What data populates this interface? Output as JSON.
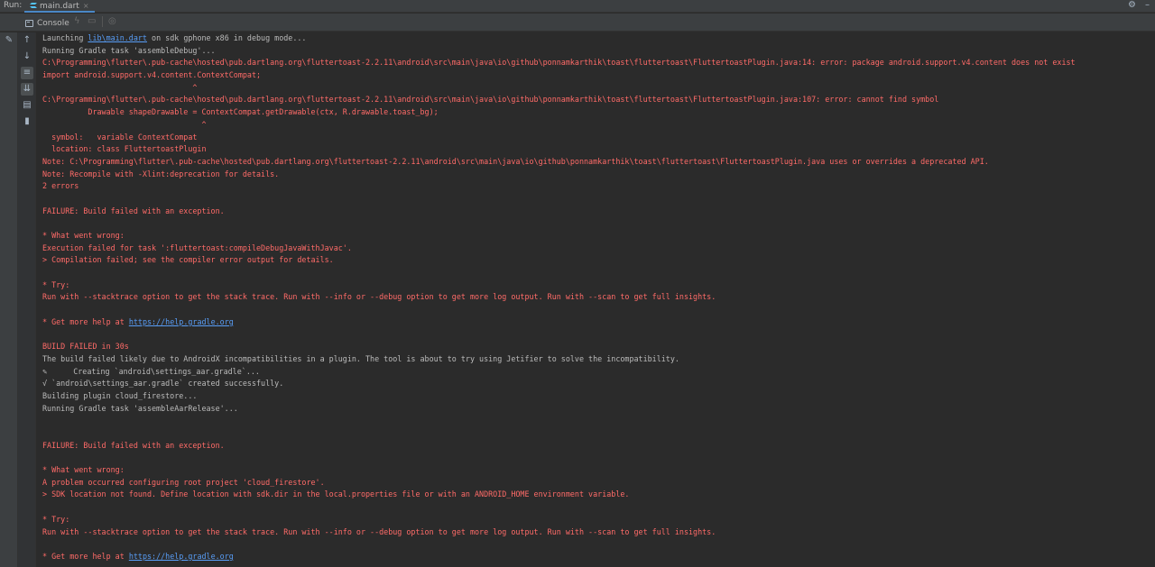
{
  "topbar": {
    "run_label": "Run:",
    "tab_label": "main.dart",
    "tab_close": "×",
    "settings_glyph": "⚙",
    "minimize_glyph": "–"
  },
  "toolbar": {
    "console_label": "Console"
  },
  "console": {
    "lines": [
      {
        "type": "normal",
        "segments": [
          {
            "text": "Launching "
          },
          {
            "text": "lib\\main.dart",
            "link": true
          },
          {
            "text": " on sdk gphone x86 in debug mode..."
          }
        ]
      },
      {
        "type": "normal",
        "text": "Running Gradle task 'assembleDebug'..."
      },
      {
        "type": "error",
        "text": "C:\\Programming\\flutter\\.pub-cache\\hosted\\pub.dartlang.org\\fluttertoast-2.2.11\\android\\src\\main\\java\\io\\github\\ponnamkarthik\\toast\\fluttertoast\\FluttertoastPlugin.java:14: error: package android.support.v4.content does not exist"
      },
      {
        "type": "error",
        "text": "import android.support.v4.content.ContextCompat;"
      },
      {
        "type": "error",
        "text": "                                 ^"
      },
      {
        "type": "error",
        "text": "C:\\Programming\\flutter\\.pub-cache\\hosted\\pub.dartlang.org\\fluttertoast-2.2.11\\android\\src\\main\\java\\io\\github\\ponnamkarthik\\toast\\fluttertoast\\FluttertoastPlugin.java:107: error: cannot find symbol"
      },
      {
        "type": "error",
        "text": "          Drawable shapeDrawable = ContextCompat.getDrawable(ctx, R.drawable.toast_bg);"
      },
      {
        "type": "error",
        "text": "                                   ^"
      },
      {
        "type": "error",
        "text": "  symbol:   variable ContextCompat"
      },
      {
        "type": "error",
        "text": "  location: class FluttertoastPlugin"
      },
      {
        "type": "error",
        "text": "Note: C:\\Programming\\flutter\\.pub-cache\\hosted\\pub.dartlang.org\\fluttertoast-2.2.11\\android\\src\\main\\java\\io\\github\\ponnamkarthik\\toast\\fluttertoast\\FluttertoastPlugin.java uses or overrides a deprecated API."
      },
      {
        "type": "error",
        "text": "Note: Recompile with -Xlint:deprecation for details."
      },
      {
        "type": "error",
        "text": "2 errors"
      },
      {
        "type": "blank",
        "text": ""
      },
      {
        "type": "error",
        "text": "FAILURE: Build failed with an exception."
      },
      {
        "type": "blank",
        "text": ""
      },
      {
        "type": "error",
        "text": "* What went wrong:"
      },
      {
        "type": "error",
        "text": "Execution failed for task ':fluttertoast:compileDebugJavaWithJavac'."
      },
      {
        "type": "error",
        "text": "> Compilation failed; see the compiler error output for details."
      },
      {
        "type": "blank",
        "text": ""
      },
      {
        "type": "error",
        "text": "* Try:"
      },
      {
        "type": "error",
        "text": "Run with --stacktrace option to get the stack trace. Run with --info or --debug option to get more log output. Run with --scan to get full insights."
      },
      {
        "type": "blank",
        "text": ""
      },
      {
        "type": "error",
        "segments": [
          {
            "text": "* Get more help at "
          },
          {
            "text": "https://help.gradle.org",
            "link": true
          }
        ]
      },
      {
        "type": "blank",
        "text": ""
      },
      {
        "type": "error",
        "text": "BUILD FAILED in 30s"
      },
      {
        "type": "normal",
        "text": "The build failed likely due to AndroidX incompatibilities in a plugin. The tool is about to try using Jetifier to solve the incompatibility."
      },
      {
        "type": "normal",
        "pencil": "✎",
        "text": "     Creating `android\\settings_aar.gradle`..."
      },
      {
        "type": "normal",
        "text": "√ `android\\settings_aar.gradle` created successfully."
      },
      {
        "type": "normal",
        "text": "Building plugin cloud_firestore..."
      },
      {
        "type": "normal",
        "text": "Running Gradle task 'assembleAarRelease'..."
      },
      {
        "type": "blank",
        "text": ""
      },
      {
        "type": "blank",
        "text": ""
      },
      {
        "type": "error",
        "text": "FAILURE: Build failed with an exception."
      },
      {
        "type": "blank",
        "text": ""
      },
      {
        "type": "error",
        "text": "* What went wrong:"
      },
      {
        "type": "error",
        "text": "A problem occurred configuring root project 'cloud_firestore'."
      },
      {
        "type": "error",
        "text": "> SDK location not found. Define location with sdk.dir in the local.properties file or with an ANDROID_HOME environment variable."
      },
      {
        "type": "blank",
        "text": ""
      },
      {
        "type": "error",
        "text": "* Try:"
      },
      {
        "type": "error",
        "text": "Run with --stacktrace option to get the stack trace. Run with --info or --debug option to get more log output. Run with --scan to get full insights."
      },
      {
        "type": "blank",
        "text": ""
      },
      {
        "type": "error",
        "segments": [
          {
            "text": "* Get more help at "
          },
          {
            "text": "https://help.gradle.org",
            "link": true
          }
        ]
      }
    ]
  }
}
